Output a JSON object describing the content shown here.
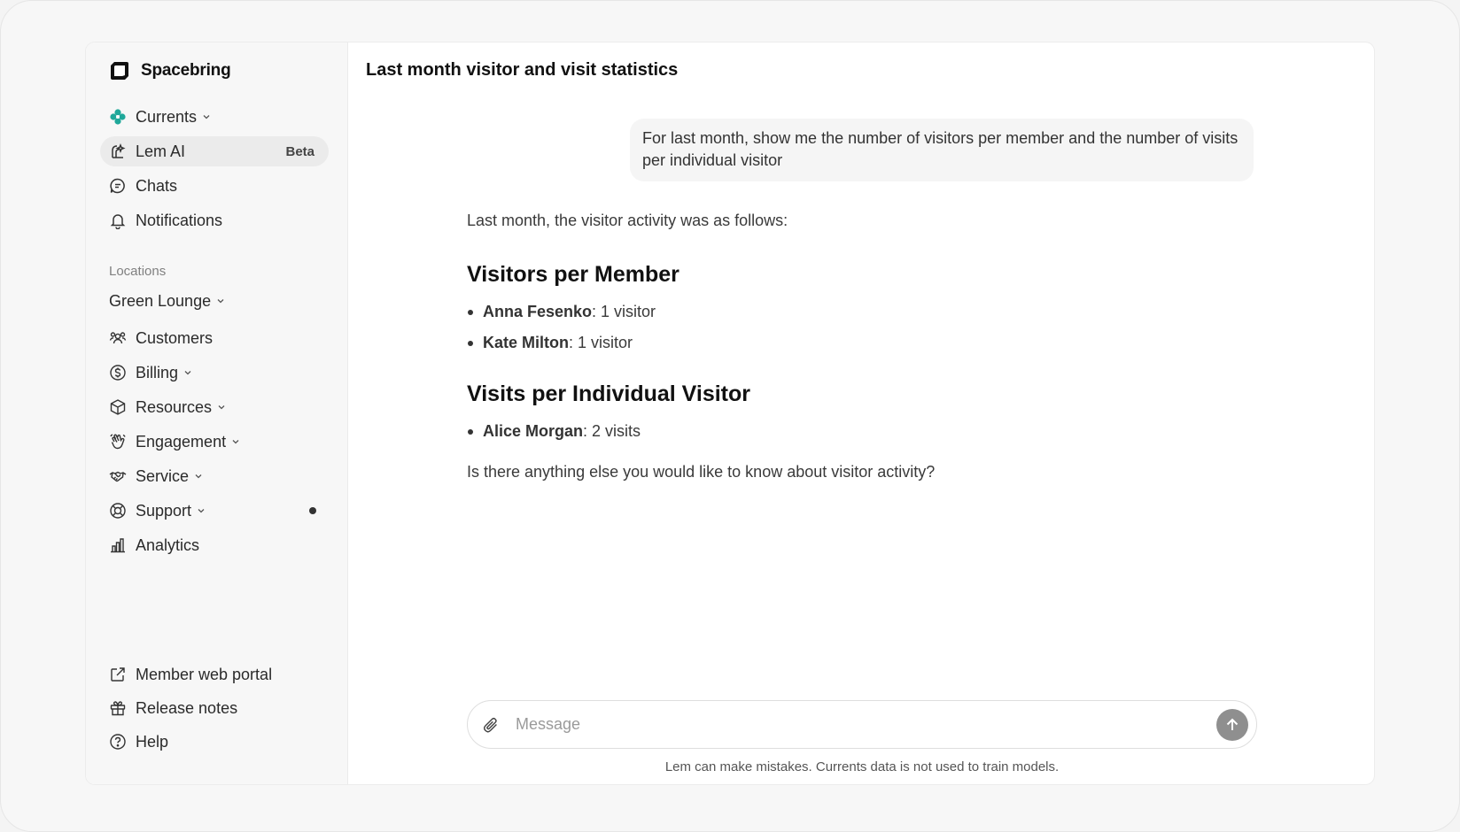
{
  "brand": {
    "name": "Spacebring"
  },
  "sidebar": {
    "nav": [
      {
        "label": "Currents",
        "icon": "currents-icon",
        "has_chevron": true
      },
      {
        "label": "Lem AI",
        "icon": "lem-ai-icon",
        "badge": "Beta",
        "active": true
      },
      {
        "label": "Chats",
        "icon": "chat-icon"
      },
      {
        "label": "Notifications",
        "icon": "bell-icon"
      }
    ],
    "locations_label": "Locations",
    "location_selected": "Green Lounge",
    "location_nav": [
      {
        "label": "Customers",
        "icon": "customers-icon"
      },
      {
        "label": "Billing",
        "icon": "billing-icon",
        "has_chevron": true
      },
      {
        "label": "Resources",
        "icon": "cube-icon",
        "has_chevron": true
      },
      {
        "label": "Engagement",
        "icon": "wave-hand-icon",
        "has_chevron": true
      },
      {
        "label": "Service",
        "icon": "handshake-icon",
        "has_chevron": true
      },
      {
        "label": "Support",
        "icon": "lifebuoy-icon",
        "has_chevron": true,
        "dot": true
      },
      {
        "label": "Analytics",
        "icon": "bar-chart-icon"
      }
    ],
    "footer": [
      {
        "label": "Member web portal",
        "icon": "external-link-icon"
      },
      {
        "label": "Release notes",
        "icon": "gift-icon"
      },
      {
        "label": "Help",
        "icon": "help-circle-icon"
      }
    ]
  },
  "main": {
    "title": "Last month visitor and visit statistics",
    "user_message": "For last month, show me the number of visitors per member and the number of visits per individual visitor",
    "reply": {
      "intro": "Last month, the visitor activity was as follows:",
      "section1_title": "Visitors per Member",
      "section1_items": [
        {
          "name": "Anna Fesenko",
          "value": ": 1 visitor"
        },
        {
          "name": "Kate Milton",
          "value": ": 1 visitor"
        }
      ],
      "section2_title": "Visits per Individual Visitor",
      "section2_items": [
        {
          "name": "Alice Morgan",
          "value": ": 2 visits"
        }
      ],
      "outro": "Is there anything else you would like to know about visitor activity?"
    },
    "composer": {
      "placeholder": "Message"
    },
    "disclaimer": "Lem can make mistakes. Currents data is not used to train models."
  },
  "colors": {
    "accent": "#1fa89a",
    "send_button": "#8f8f8f",
    "active_nav_bg": "#ebebeb"
  }
}
